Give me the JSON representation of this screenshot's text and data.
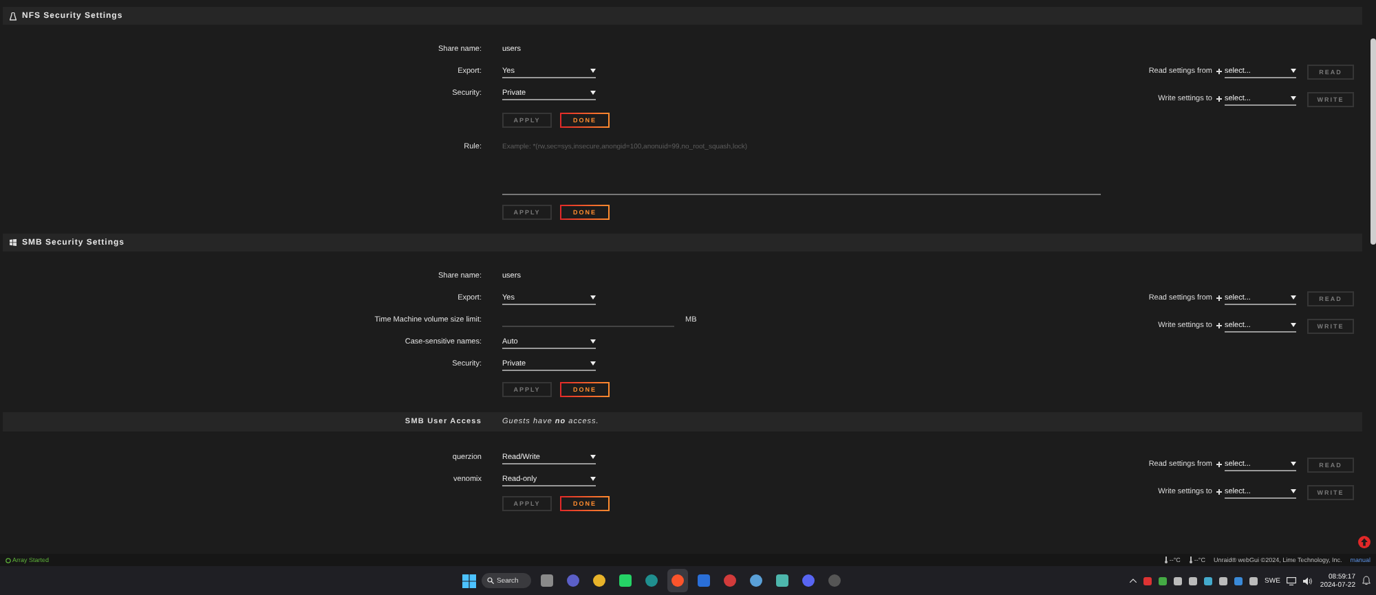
{
  "nfs_security": {
    "title": "NFS Security Settings",
    "fields": [
      {
        "label": "Share name:",
        "kind": "text",
        "value": "users"
      },
      {
        "label": "Export:",
        "kind": "select",
        "value": "Yes"
      },
      {
        "label": "Security:",
        "kind": "select",
        "value": "Private"
      }
    ],
    "buttons": [
      {
        "label": "APPLY",
        "disabled": true
      },
      {
        "label": "DONE",
        "disabled": false
      }
    ],
    "rule": {
      "label": "Rule:",
      "placeholder": "Example: *(rw,sec=sys,insecure,anongid=100,anonuid=99,no_root_squash,lock)"
    },
    "rule_buttons": [
      {
        "label": "APPLY",
        "disabled": true
      },
      {
        "label": "DONE",
        "disabled": false
      }
    ],
    "copy_tools": [
      {
        "label": "Read settings from",
        "value": "select...",
        "button": "READ",
        "disabled": true
      },
      {
        "label": "Write settings to",
        "value": "select...",
        "button": "WRITE",
        "disabled": true
      }
    ]
  },
  "smb_security": {
    "title": "SMB Security Settings",
    "fields": [
      {
        "label": "Share name:",
        "kind": "text",
        "value": "users"
      },
      {
        "label": "Export:",
        "kind": "select",
        "value": "Yes"
      },
      {
        "label": "Time Machine volume size limit:",
        "kind": "input",
        "unit": "MB"
      },
      {
        "label": "Case-sensitive names:",
        "kind": "select",
        "value": "Auto"
      },
      {
        "label": "Security:",
        "kind": "select",
        "value": "Private"
      }
    ],
    "buttons": [
      {
        "label": "APPLY",
        "disabled": true
      },
      {
        "label": "DONE",
        "disabled": false
      }
    ],
    "copy_tools": [
      {
        "label": "Read settings from",
        "value": "select...",
        "button": "READ",
        "disabled": true
      },
      {
        "label": "Write settings to",
        "value": "select...",
        "button": "WRITE",
        "disabled": true
      }
    ]
  },
  "smb_user_access": {
    "title": "SMB User Access",
    "note": "Guests have **no** access.",
    "fields": [
      {
        "label": "querzion",
        "kind": "select",
        "value": "Read/Write"
      },
      {
        "label": "venomix",
        "kind": "select",
        "value": "Read-only"
      }
    ],
    "buttons": [
      {
        "label": "APPLY",
        "disabled": true
      },
      {
        "label": "DONE",
        "disabled": false
      }
    ],
    "copy_tools": [
      {
        "label": "Read settings from",
        "value": "select...",
        "button": "READ",
        "disabled": true
      },
      {
        "label": "Write settings to",
        "value": "select...",
        "button": "WRITE",
        "disabled": true
      }
    ]
  },
  "status_bar": {
    "array_status": "Array Started",
    "temps": [
      "--°C",
      "--°C"
    ],
    "copyright": "Unraid® webGui ©2024, Lime Technology, Inc.",
    "link": "manual"
  },
  "taskbar": {
    "search": "Search",
    "apps": [
      {
        "selected": false
      },
      {
        "selected": false
      },
      {
        "selected": false
      },
      {
        "selected": false
      },
      {
        "selected": false
      },
      {
        "selected": true
      },
      {
        "selected": false
      },
      {
        "selected": false
      },
      {
        "selected": false
      },
      {
        "selected": false
      },
      {
        "selected": false
      },
      {
        "selected": false
      }
    ],
    "language": "SWE",
    "time": "08:59:17",
    "date": "2024-07-22"
  }
}
